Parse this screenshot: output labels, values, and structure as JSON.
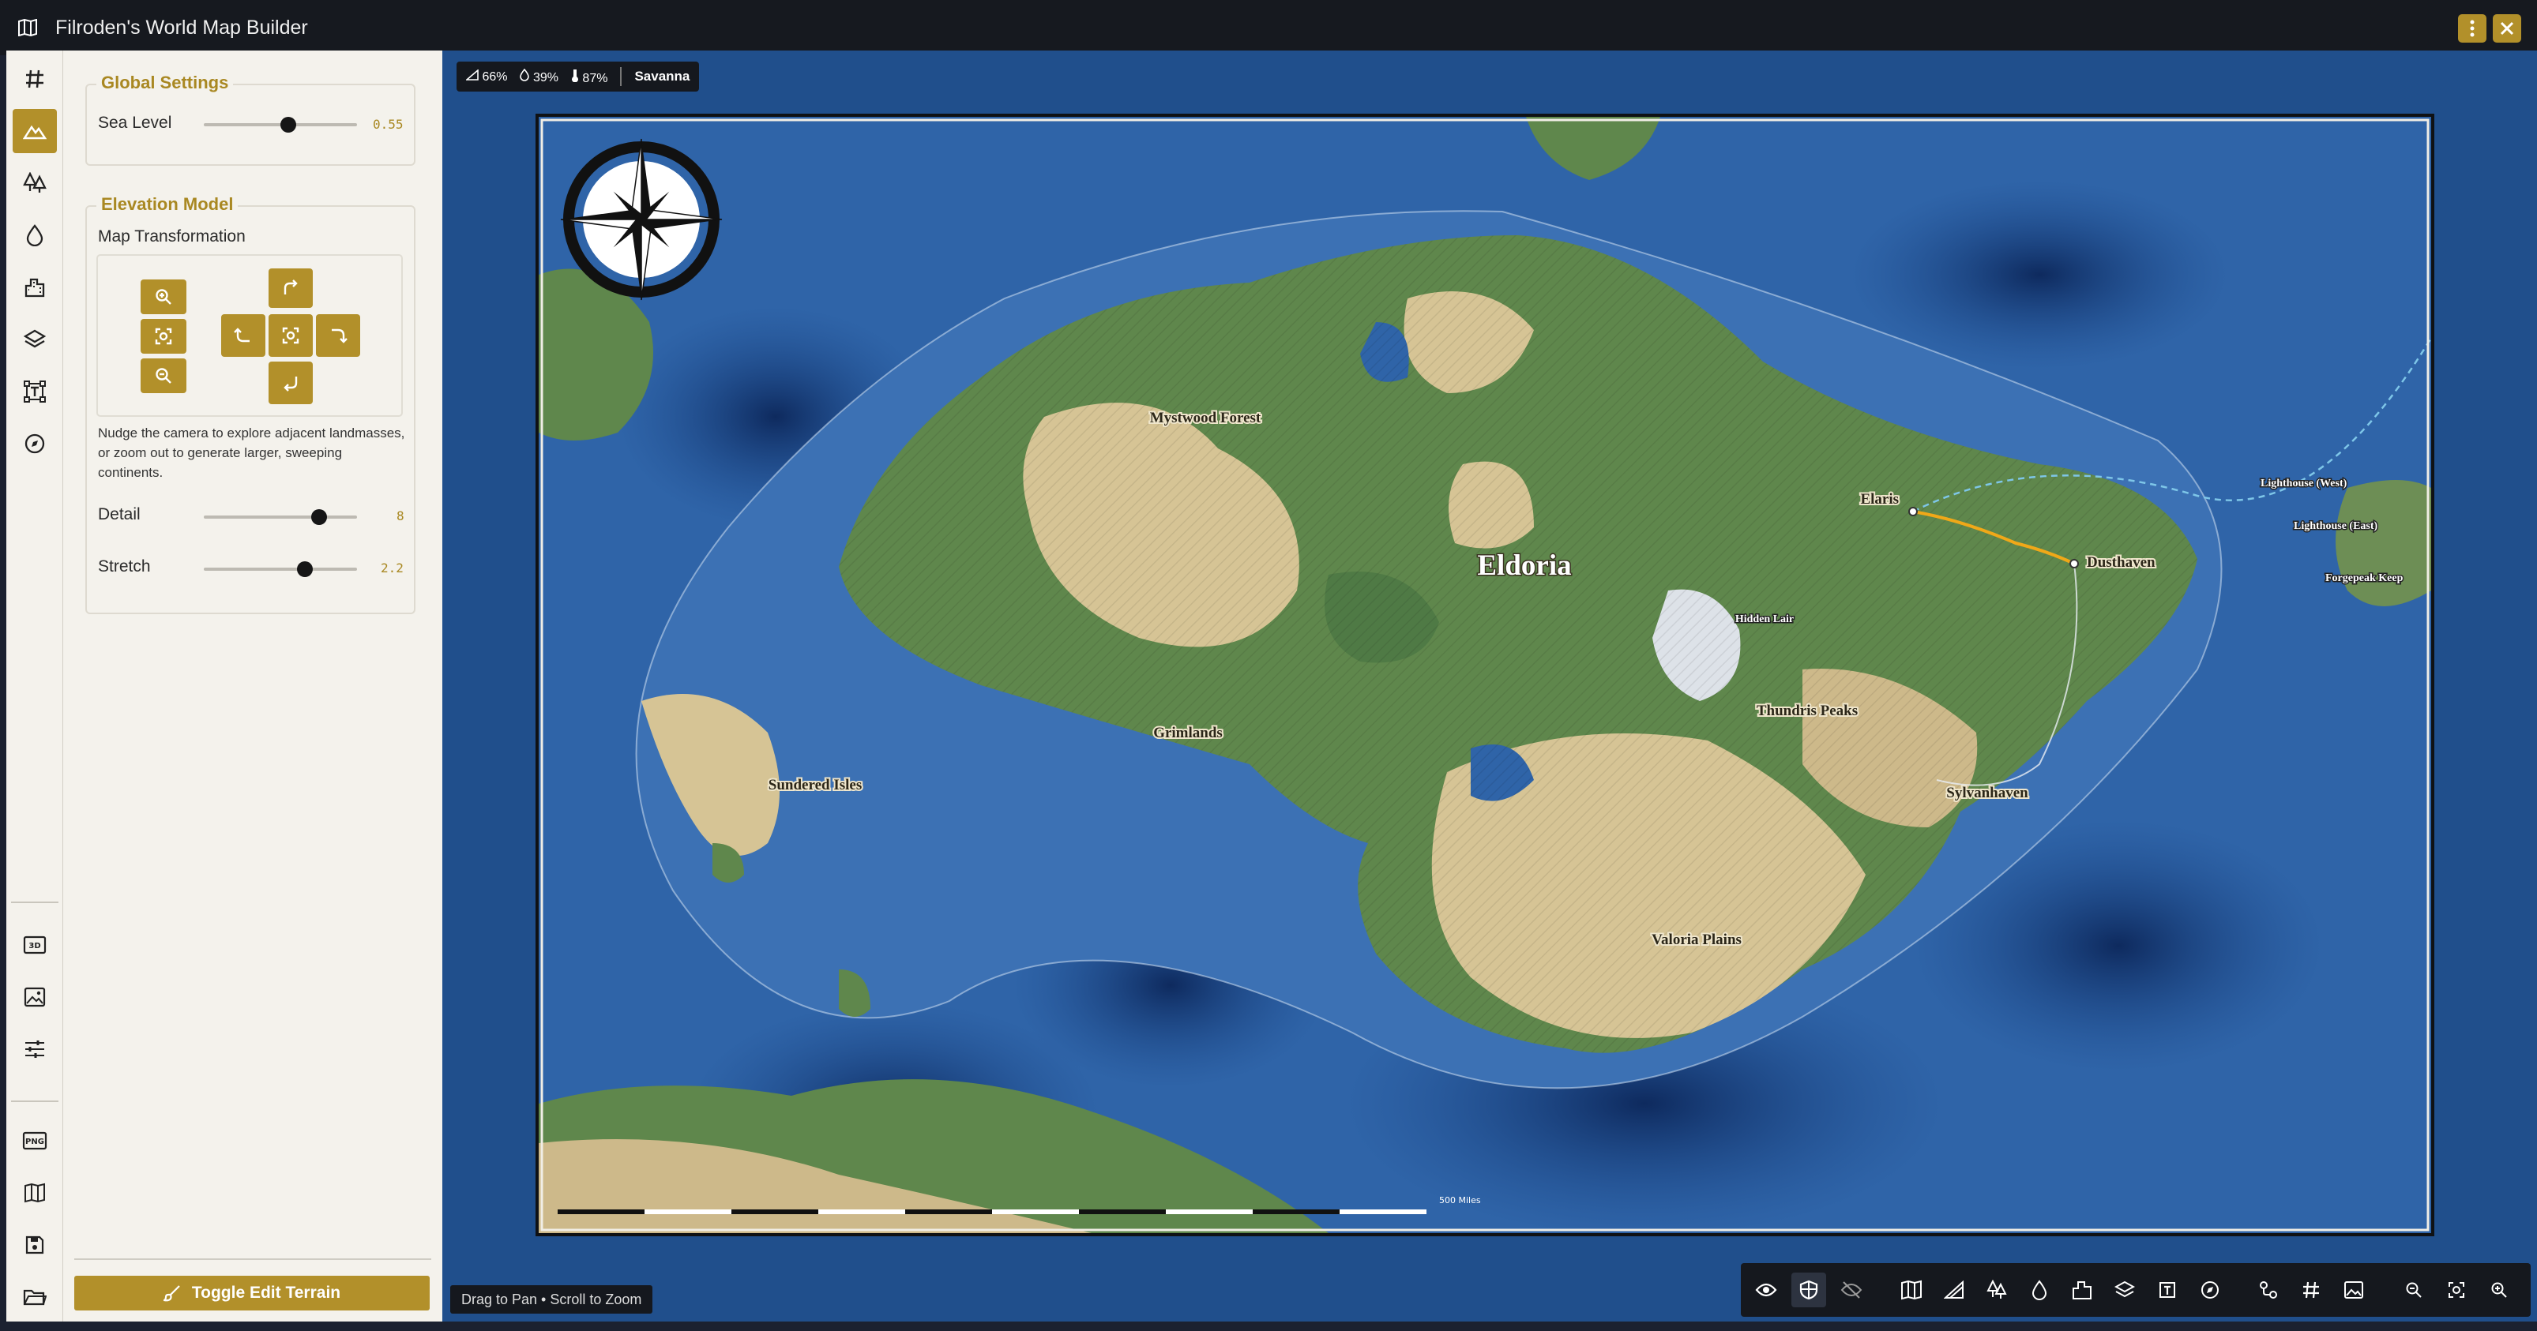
{
  "app": {
    "title": "Filroden's World Map Builder"
  },
  "global_settings": {
    "title": "Global Settings",
    "sea_level": {
      "label": "Sea Level",
      "value": "0.55",
      "fraction": 0.55
    }
  },
  "elevation_model": {
    "title": "Elevation Model",
    "map_transformation_label": "Map Transformation",
    "description": "Nudge the camera to explore adjacent landmasses, or zoom out to generate larger, sweeping continents.",
    "detail": {
      "label": "Detail",
      "value": "8",
      "fraction": 0.75
    },
    "stretch": {
      "label": "Stretch",
      "value": "2.2",
      "fraction": 0.66
    }
  },
  "toggle_edit": {
    "label": "Toggle Edit Terrain"
  },
  "info_bar": {
    "slope": "66%",
    "moisture": "39%",
    "temperature": "87%",
    "biome": "Savanna"
  },
  "map": {
    "title": "Eldoria",
    "labels": {
      "mystwood": "Mystwood Forest",
      "grimlands": "Grimlands",
      "sundered": "Sundered Isles",
      "thundris": "Thundris Peaks",
      "hidden_lair": "Hidden Lair",
      "valoria": "Valoria Plains",
      "sylvanhaven": "Sylvanhaven",
      "elaris": "Elaris",
      "dusthaven": "Dusthaven",
      "lighthouse_west": "Lighthouse (West)",
      "lighthouse_east": "Lighthouse (East)",
      "forgepeak": "Forgepeak Keep",
      "scale": "500 Miles"
    }
  },
  "hint": {
    "text": "Drag to Pan • Scroll to Zoom"
  },
  "rail_icons": [
    "grid-icon",
    "mountain-icon",
    "trees-icon",
    "water-drop-icon",
    "city-icon",
    "layers-icon",
    "text-frame-icon",
    "compass-icon",
    "3d-icon",
    "image-icon",
    "sliders-icon",
    "png-icon",
    "map-icon",
    "save-icon",
    "folder-icon"
  ],
  "toolbar_icons": [
    "eye-icon",
    "shield-icon",
    "eye-off-icon",
    "map-icon",
    "terrain-slope-icon",
    "trees-icon",
    "water-drop-icon",
    "city-icon",
    "layers-icon",
    "text-frame-icon",
    "compass-icon",
    "route-icon",
    "grid-icon",
    "image-icon",
    "zoom-out-icon",
    "zoom-fit-icon",
    "zoom-in-icon"
  ],
  "colors": {
    "accent": "#b2902a",
    "dark": "#15181e",
    "ocean": "#204f8c",
    "panel": "#f4f2ec"
  }
}
